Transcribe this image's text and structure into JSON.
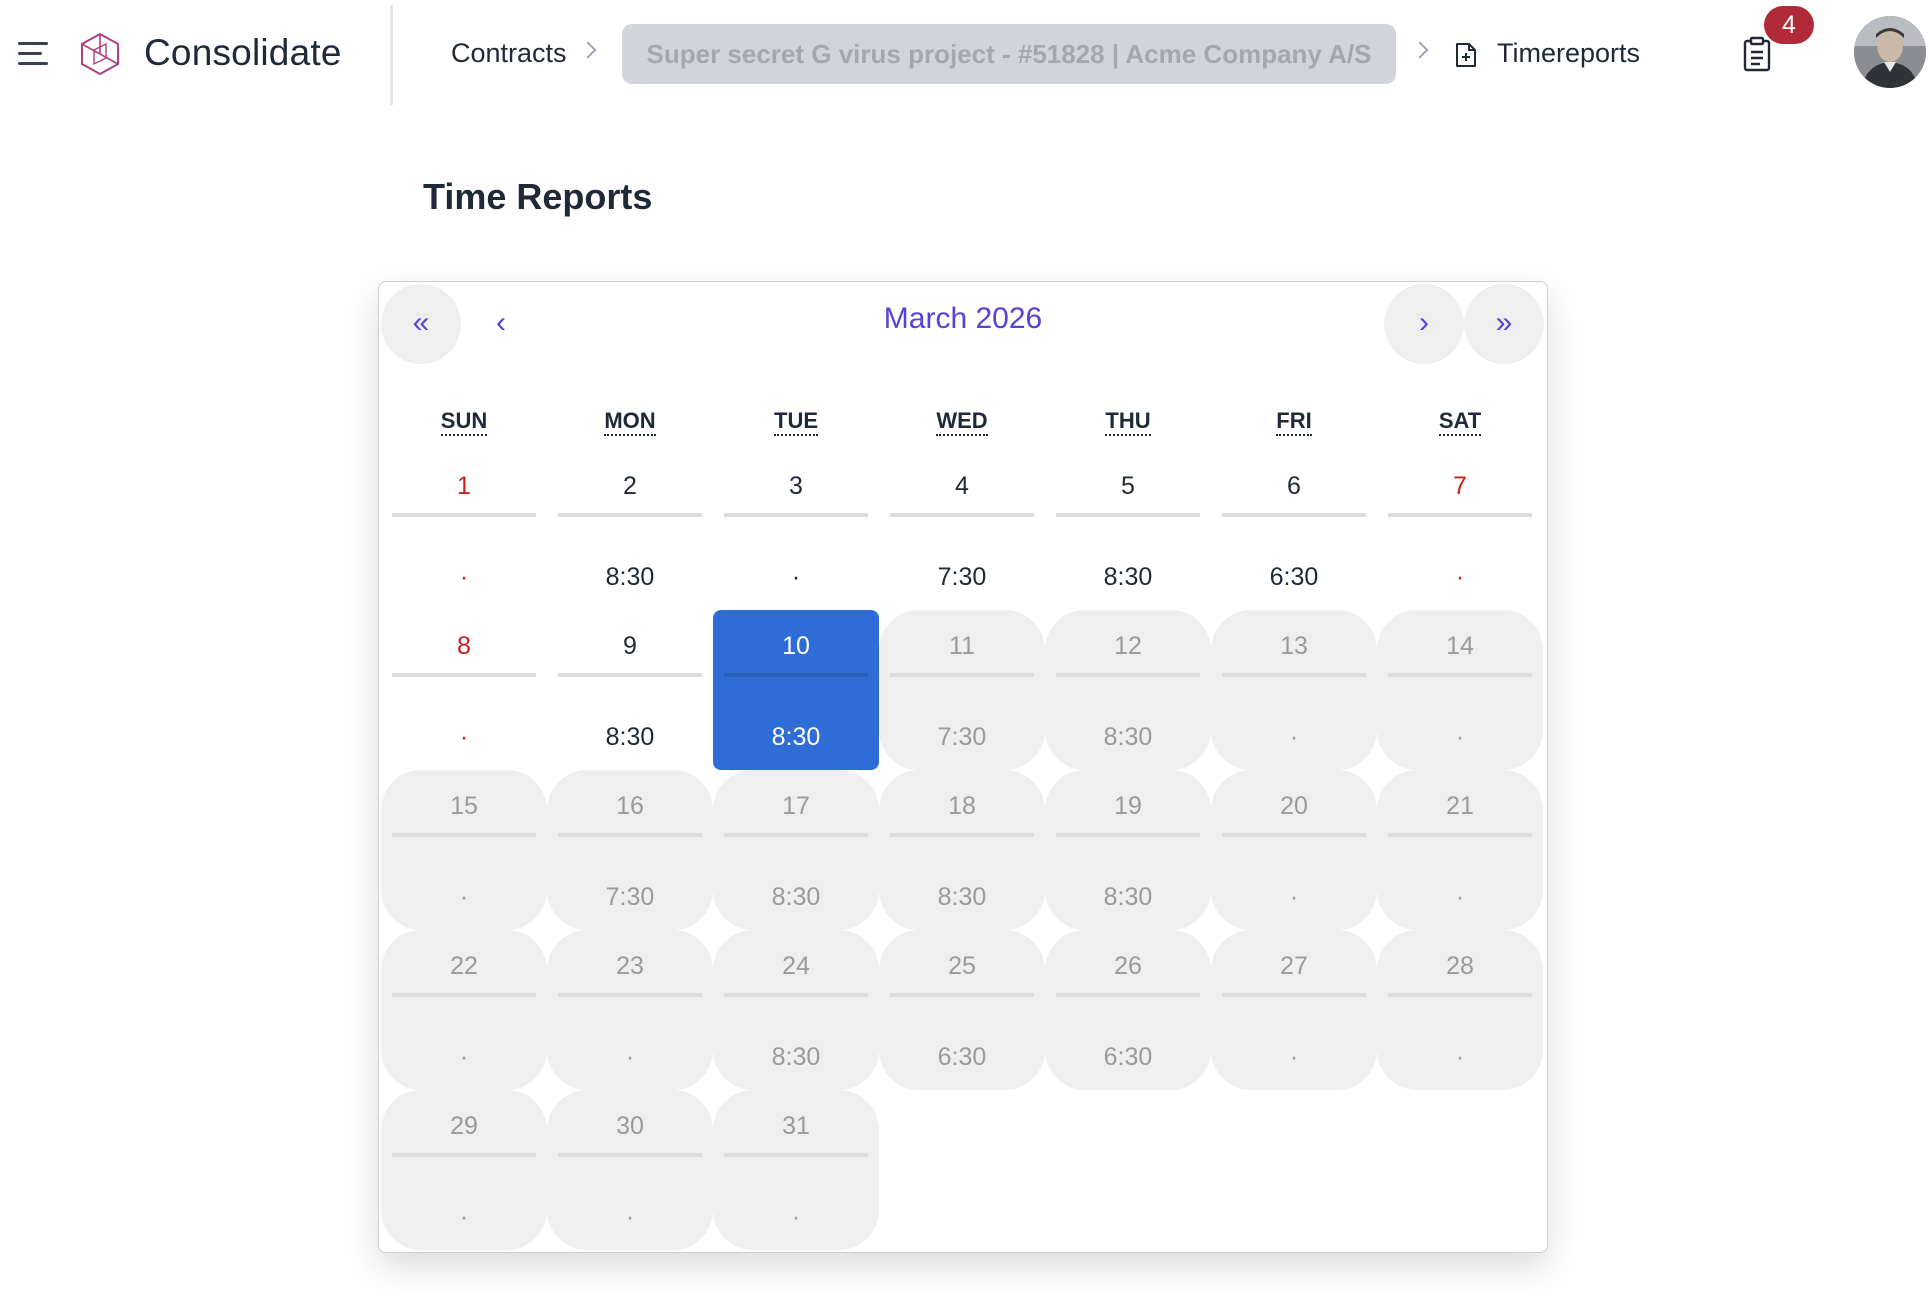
{
  "header": {
    "app_name": "Consolidate",
    "breadcrumbs": {
      "contracts": "Contracts",
      "project": "Super secret G virus project - #51828 | Acme Company A/S",
      "current": "Timereports"
    },
    "notifications_count": "4"
  },
  "page": {
    "title": "Time Reports"
  },
  "calendar": {
    "month_label": "March 2026",
    "nav": {
      "prev_year": "«",
      "prev_month": "‹",
      "next_month": "›",
      "next_year": "»"
    },
    "weekdays": [
      "SUN",
      "MON",
      "TUE",
      "WED",
      "THU",
      "FRI",
      "SAT"
    ],
    "days": [
      {
        "day": "1",
        "hours": "·",
        "state": "weekend"
      },
      {
        "day": "2",
        "hours": "8:30",
        "state": "normal"
      },
      {
        "day": "3",
        "hours": "·",
        "state": "normal"
      },
      {
        "day": "4",
        "hours": "7:30",
        "state": "normal"
      },
      {
        "day": "5",
        "hours": "8:30",
        "state": "normal"
      },
      {
        "day": "6",
        "hours": "6:30",
        "state": "normal"
      },
      {
        "day": "7",
        "hours": "·",
        "state": "weekend"
      },
      {
        "day": "8",
        "hours": "·",
        "state": "weekend"
      },
      {
        "day": "9",
        "hours": "8:30",
        "state": "normal"
      },
      {
        "day": "10",
        "hours": "8:30",
        "state": "selected"
      },
      {
        "day": "11",
        "hours": "7:30",
        "state": "future"
      },
      {
        "day": "12",
        "hours": "8:30",
        "state": "future"
      },
      {
        "day": "13",
        "hours": "·",
        "state": "future"
      },
      {
        "day": "14",
        "hours": "·",
        "state": "future"
      },
      {
        "day": "15",
        "hours": "·",
        "state": "future"
      },
      {
        "day": "16",
        "hours": "7:30",
        "state": "future"
      },
      {
        "day": "17",
        "hours": "8:30",
        "state": "future"
      },
      {
        "day": "18",
        "hours": "8:30",
        "state": "future"
      },
      {
        "day": "19",
        "hours": "8:30",
        "state": "future"
      },
      {
        "day": "20",
        "hours": "·",
        "state": "future"
      },
      {
        "day": "21",
        "hours": "·",
        "state": "future"
      },
      {
        "day": "22",
        "hours": "·",
        "state": "future"
      },
      {
        "day": "23",
        "hours": "·",
        "state": "future"
      },
      {
        "day": "24",
        "hours": "8:30",
        "state": "future"
      },
      {
        "day": "25",
        "hours": "6:30",
        "state": "future"
      },
      {
        "day": "26",
        "hours": "6:30",
        "state": "future"
      },
      {
        "day": "27",
        "hours": "·",
        "state": "future"
      },
      {
        "day": "28",
        "hours": "·",
        "state": "future"
      },
      {
        "day": "29",
        "hours": "·",
        "state": "future"
      },
      {
        "day": "30",
        "hours": "·",
        "state": "future"
      },
      {
        "day": "31",
        "hours": "·",
        "state": "future"
      }
    ]
  },
  "colors": {
    "accent": "#5b3fd6",
    "selected": "#2f6dd6",
    "weekend": "#c81e1e",
    "badge": "#b02a37",
    "future_bg": "#efefef"
  }
}
